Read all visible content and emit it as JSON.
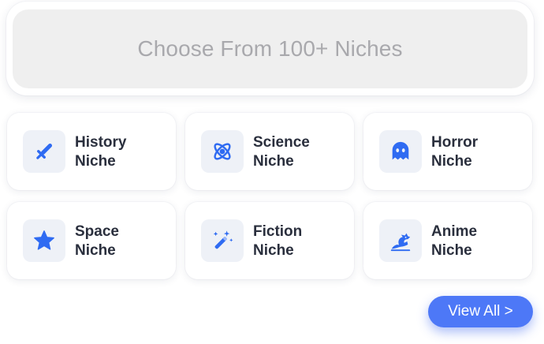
{
  "header": {
    "title": "Choose From 100+ Niches"
  },
  "niches": [
    {
      "line1": "History",
      "line2": "Niche",
      "icon": "sword-icon"
    },
    {
      "line1": "Science",
      "line2": "Niche",
      "icon": "atom-icon"
    },
    {
      "line1": "Horror",
      "line2": "Niche",
      "icon": "ghost-icon"
    },
    {
      "line1": "Space",
      "line2": "Niche",
      "icon": "star-icon"
    },
    {
      "line1": "Fiction",
      "line2": "Niche",
      "icon": "magic-wand-icon"
    },
    {
      "line1": "Anime",
      "line2": "Niche",
      "icon": "dragon-icon"
    }
  ],
  "view_all": {
    "label": "View All >"
  },
  "colors": {
    "accent": "#4d78f7",
    "icon": "#2f6bf2",
    "icon_bg": "#eef1f7",
    "header_bg": "#efefef",
    "header_text": "#a9a9ad",
    "label_text": "#2a2f3d"
  }
}
